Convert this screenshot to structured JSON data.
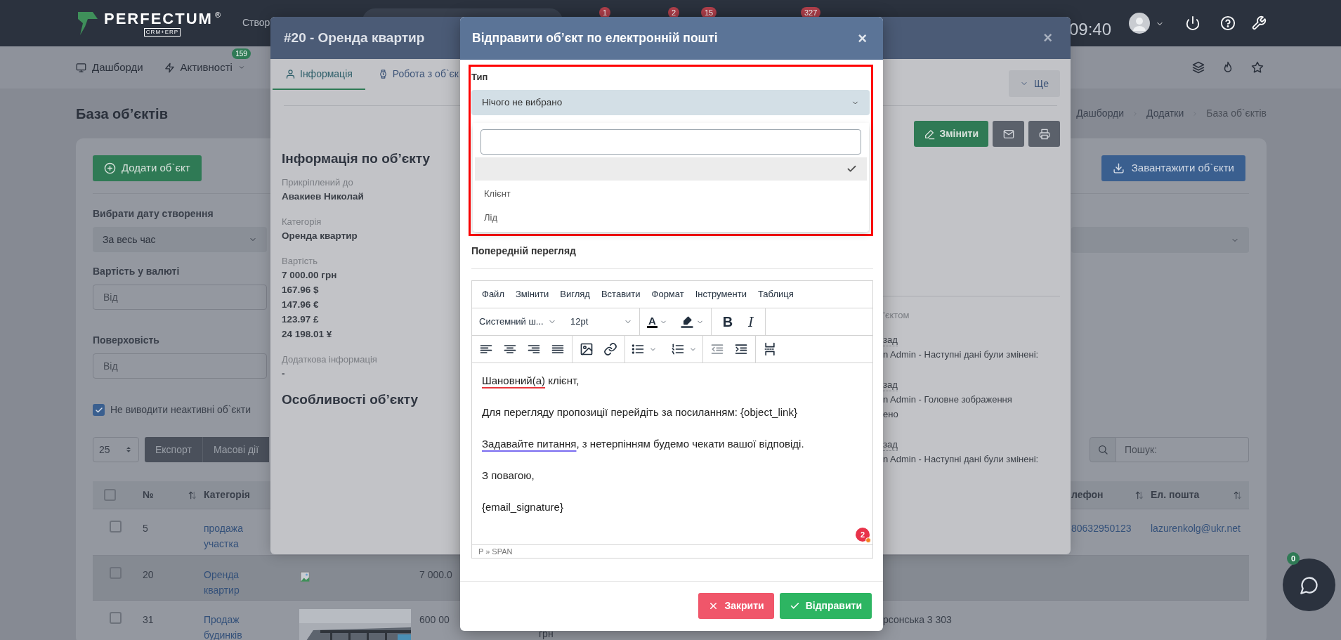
{
  "navbar": {
    "brand": "PERFECTUM",
    "brand_mark": "®",
    "brand_tagline": "CRM+ERP",
    "create_label": "Створ",
    "badges": [
      "1",
      "2",
      "15",
      "327"
    ],
    "time": "09:40"
  },
  "subnav": {
    "items": [
      {
        "label": "Дашборди"
      },
      {
        "label": "Активності",
        "badge": "159"
      }
    ]
  },
  "page": {
    "title": "База об’єктів",
    "breadcrumbs": [
      {
        "label": "Дашборди",
        "current": false
      },
      {
        "label": "Додатки",
        "current": false
      },
      {
        "label": "База об`єктів",
        "current": true
      }
    ]
  },
  "actions": {
    "add_button": "Додати об`єкт",
    "download_button": "Завантажити об`єкти"
  },
  "filters": [
    {
      "label": "Вибрати дату створення",
      "kind": "select",
      "value": "За весь час"
    },
    {
      "label": "Вартість у валюті",
      "kind": "input",
      "placeholder": "Від"
    },
    {
      "label": "Поверховість",
      "kind": "input",
      "placeholder": "Від"
    }
  ],
  "inactive_filter": {
    "label": "Не виводити неактивні об`єкти",
    "checked": true
  },
  "table_controls": {
    "page_size": "25",
    "buttons": [
      "Експорт",
      "Масові дії"
    ],
    "search_placeholder": "Пошук:"
  },
  "table": {
    "select_all": {
      "checked": false
    },
    "columns": [
      {
        "label": "№",
        "sortable": true
      },
      {
        "label": "Категорія"
      },
      {
        "label": "лефон",
        "sortable": true
      },
      {
        "label": "Ел. пошта",
        "sortable": true
      }
    ],
    "rows": [
      {
        "checked": false,
        "highlighted": false,
        "number": "5",
        "category": "продажа участка",
        "phone": "80632950123",
        "email": "lazurenkolg@ukr.net"
      },
      {
        "checked": false,
        "highlighted": true,
        "number": "20",
        "category": "Оренда квартир",
        "image": {
          "kind": "broken"
        },
        "price": "7 000.0"
      },
      {
        "checked": false,
        "highlighted": false,
        "number": "31",
        "category": "Продаж будинків",
        "price": "600 00",
        "column_6": "грн",
        "address": "рсонська 3 303"
      }
    ]
  },
  "chat": {
    "badge": "0"
  },
  "object_modal": {
    "title": "#20 - Оренда квартир",
    "close": "×",
    "tabs": [
      {
        "label": "Інформація",
        "selected": true
      },
      {
        "label": "Робота з об`єк",
        "selected": false
      }
    ],
    "more_button": "Ще",
    "edit_button": "Змінити",
    "info_title": "Інформація по об’єкту",
    "fields": [
      {
        "label": "Прикріплений до",
        "values": [
          "Авакиев Николай"
        ]
      },
      {
        "label": "Категорія",
        "values": [
          "Оренда квартир"
        ]
      },
      {
        "label": "Вартість",
        "values": [
          "7 000.00 грн",
          "167.96 $",
          "147.96 €",
          "123.97 £",
          "24 198.01 ¥"
        ]
      },
      {
        "label": "Додаткова інформація",
        "values": [
          "-"
        ]
      }
    ],
    "features_title": "Особливості об’єкту",
    "history_title": "’єктом",
    "history": [
      {
        "time": "зад",
        "lines": [
          "n Admin - Наступні дані були змінені:"
        ]
      },
      {
        "time": "зад",
        "lines": [
          "n Admin - Головне зображення",
          "ено"
        ]
      },
      {
        "time": "зад",
        "lines": [
          "n Admin - Наступні дані були змінені:"
        ]
      }
    ]
  },
  "email_modal": {
    "title": "Відправити об’єкт по електронній пошті",
    "close": "×",
    "type_field": {
      "label": "Тип",
      "value": "Нічого не вибрано",
      "expanded": true,
      "options": [
        {
          "selected": true
        },
        {
          "label": "Клієнт",
          "selected": false
        },
        {
          "label": "Лід",
          "selected": false
        }
      ]
    },
    "preview_label": "Попередній перегляд",
    "editor": {
      "menu": [
        "Файл",
        "Змінити",
        "Вигляд",
        "Вставити",
        "Формат",
        "Інструменти",
        "Таблиця"
      ],
      "font_family": "Системний ш...",
      "font_size": "12pt",
      "glyphs": {
        "text_color": "A",
        "bold": "B",
        "italic": "I"
      },
      "paragraphs": [
        {
          "segments": [
            {
              "text": "Шановний(а)",
              "kind": "spelling"
            },
            {
              "text": " клієнт,"
            }
          ]
        },
        {
          "segments": [
            {
              "text": "Для перегляду пропозиції перейдіть за посиланням: {object_link}"
            }
          ]
        },
        {
          "segments": [
            {
              "text": "Задавайте питання",
              "kind": "grammar"
            },
            {
              "text": ", з нетерпінням будемо чекати вашої відповіді."
            }
          ]
        },
        {
          "segments": [
            {
              "text": "З повагою,"
            }
          ]
        },
        {
          "segments": [
            {
              "text": "{email_signature}"
            }
          ]
        }
      ],
      "issue_count": "2",
      "element_path": "P » SPAN"
    },
    "buttons": [
      {
        "label": "Закрити",
        "kind": "cancel"
      },
      {
        "label": "Відправити",
        "kind": "submit"
      }
    ]
  }
}
